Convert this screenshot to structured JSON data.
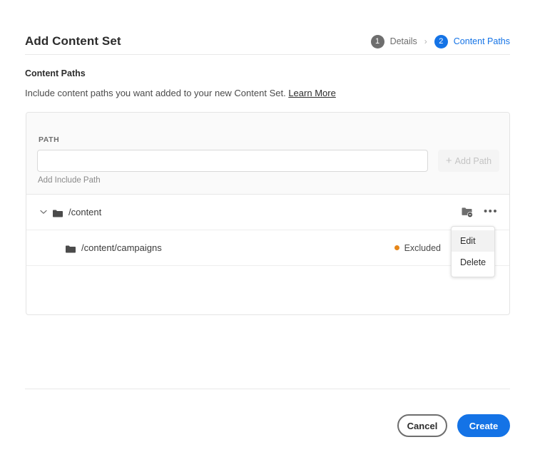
{
  "header": {
    "title": "Add Content Set",
    "steps": [
      {
        "number": "1",
        "label": "Details",
        "active": false
      },
      {
        "number": "2",
        "label": "Content Paths",
        "active": true
      }
    ],
    "separator": "›"
  },
  "section": {
    "title": "Content Paths",
    "description": "Include content paths you want added to your new Content Set.",
    "learn_more": "Learn More"
  },
  "path_form": {
    "label": "PATH",
    "input_value": "",
    "input_placeholder": "",
    "add_button": "Add Path",
    "add_button_plus": "+",
    "helper_text": "Add Include Path"
  },
  "tree": {
    "rows": [
      {
        "label": "/content",
        "chevron": "⌄",
        "status": "",
        "exclude_icon": "folder-exclude-icon",
        "more_icon": "•••"
      },
      {
        "label": "/content/campaigns",
        "status": "Excluded",
        "status_color": "#e68619"
      }
    ]
  },
  "menu": {
    "items": [
      {
        "label": "Edit",
        "hovered": true
      },
      {
        "label": "Delete",
        "hovered": false
      }
    ]
  },
  "footer": {
    "cancel": "Cancel",
    "create": "Create"
  },
  "colors": {
    "accent_blue": "#1473e6",
    "step_inactive": "#6e6e6e",
    "status_orange": "#e68619"
  }
}
